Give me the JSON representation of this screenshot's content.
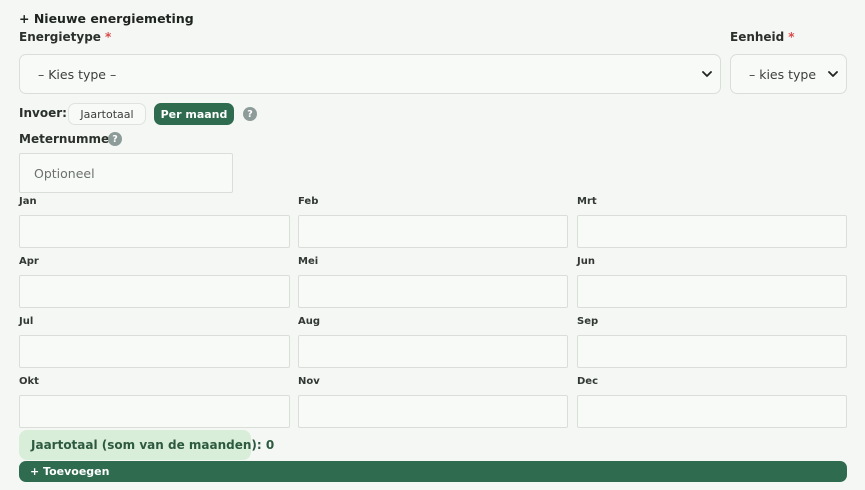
{
  "form": {
    "title": "+ Nieuwe energiemeting",
    "energietype": {
      "label": "Energietype",
      "required_mark": "*",
      "selected": "– Kies type –"
    },
    "eenheid": {
      "label": "Eenheid",
      "required_mark": "*",
      "selected": "– kies type"
    },
    "invoer": {
      "label": "Invoer:",
      "options": [
        "Jaartotaal",
        "Per maand"
      ],
      "active": "Per maand"
    },
    "help_glyph": "?",
    "meternummer": {
      "label": "Meternummer",
      "placeholder": "Optioneel"
    },
    "months": [
      {
        "label": "Jan",
        "value": ""
      },
      {
        "label": "Feb",
        "value": ""
      },
      {
        "label": "Mrt",
        "value": ""
      },
      {
        "label": "Apr",
        "value": ""
      },
      {
        "label": "Mei",
        "value": ""
      },
      {
        "label": "Jun",
        "value": ""
      },
      {
        "label": "Jul",
        "value": ""
      },
      {
        "label": "Aug",
        "value": ""
      },
      {
        "label": "Sep",
        "value": ""
      },
      {
        "label": "Okt",
        "value": ""
      },
      {
        "label": "Nov",
        "value": ""
      },
      {
        "label": "Dec",
        "value": ""
      }
    ],
    "total_text": "Jaartotaal (som van de maanden): 0",
    "add_button": "+ Toevoegen"
  },
  "colors": {
    "accent": "#2e6b4f",
    "total_bg": "#d8eed9",
    "required": "#d94a4a",
    "page_bg": "#f4f7f4"
  },
  "icons": {
    "help": "question-circle-icon",
    "select_arrow": "chevron-down-icon"
  }
}
